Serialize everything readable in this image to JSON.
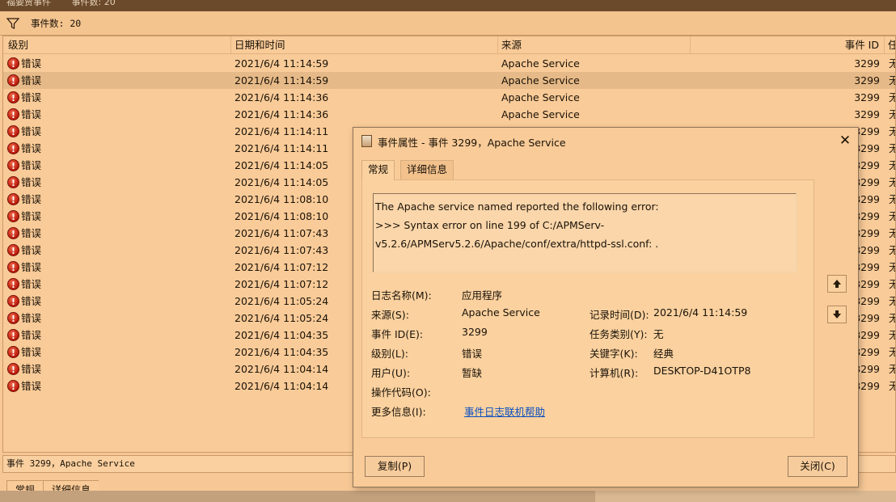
{
  "window": {
    "title_left": "福要贾事件",
    "title_right": "事件数: 20"
  },
  "filter": {
    "count_label": "事件数: 20"
  },
  "list": {
    "columns": [
      "级别",
      "日期和时间",
      "来源",
      "事件 ID",
      "任"
    ],
    "rows": [
      {
        "level": "错误",
        "datetime": "2021/6/4 11:14:59",
        "source": "Apache Service",
        "id": "3299",
        "task": "无"
      },
      {
        "level": "错误",
        "datetime": "2021/6/4 11:14:59",
        "source": "Apache Service",
        "id": "3299",
        "task": "无"
      },
      {
        "level": "错误",
        "datetime": "2021/6/4 11:14:36",
        "source": "Apache Service",
        "id": "3299",
        "task": "无"
      },
      {
        "level": "错误",
        "datetime": "2021/6/4 11:14:36",
        "source": "Apache Service",
        "id": "3299",
        "task": "无"
      },
      {
        "level": "错误",
        "datetime": "2021/6/4 11:14:11",
        "source": "",
        "id": "3299",
        "task": "无"
      },
      {
        "level": "错误",
        "datetime": "2021/6/4 11:14:11",
        "source": "",
        "id": "3299",
        "task": "无"
      },
      {
        "level": "错误",
        "datetime": "2021/6/4 11:14:05",
        "source": "",
        "id": "3299",
        "task": "无"
      },
      {
        "level": "错误",
        "datetime": "2021/6/4 11:14:05",
        "source": "",
        "id": "3299",
        "task": "无"
      },
      {
        "level": "错误",
        "datetime": "2021/6/4 11:08:10",
        "source": "",
        "id": "3299",
        "task": "无"
      },
      {
        "level": "错误",
        "datetime": "2021/6/4 11:08:10",
        "source": "",
        "id": "3299",
        "task": "无"
      },
      {
        "level": "错误",
        "datetime": "2021/6/4 11:07:43",
        "source": "",
        "id": "3299",
        "task": "无"
      },
      {
        "level": "错误",
        "datetime": "2021/6/4 11:07:43",
        "source": "",
        "id": "3299",
        "task": "无"
      },
      {
        "level": "错误",
        "datetime": "2021/6/4 11:07:12",
        "source": "",
        "id": "3299",
        "task": "无"
      },
      {
        "level": "错误",
        "datetime": "2021/6/4 11:07:12",
        "source": "",
        "id": "3299",
        "task": "无"
      },
      {
        "level": "错误",
        "datetime": "2021/6/4 11:05:24",
        "source": "",
        "id": "3299",
        "task": "无"
      },
      {
        "level": "错误",
        "datetime": "2021/6/4 11:05:24",
        "source": "",
        "id": "3299",
        "task": "无"
      },
      {
        "level": "错误",
        "datetime": "2021/6/4 11:04:35",
        "source": "",
        "id": "3299",
        "task": "无"
      },
      {
        "level": "错误",
        "datetime": "2021/6/4 11:04:35",
        "source": "",
        "id": "3299",
        "task": "无"
      },
      {
        "level": "错误",
        "datetime": "2021/6/4 11:04:14",
        "source": "",
        "id": "3299",
        "task": "无"
      },
      {
        "level": "错误",
        "datetime": "2021/6/4 11:04:14",
        "source": "",
        "id": "3299",
        "task": "无"
      }
    ]
  },
  "status": {
    "text": "事件 3299，Apache Service"
  },
  "bottom_tabs": [
    "常规",
    "详细信息"
  ],
  "dialog": {
    "title": "事件属性 - 事件 3299，Apache Service",
    "close_glyph": "✕",
    "tabs": [
      "常规",
      "详细信息"
    ],
    "message_lines": [
      "The Apache service named  reported the following error:",
      ">>> Syntax error on line 199 of C:/APMServ-",
      "v5.2.6/APMServ5.2.6/Apache/conf/extra/httpd-ssl.conf:     ."
    ],
    "fields": {
      "log_name_label": "日志名称(M):",
      "log_name": "应用程序",
      "source_label": "来源(S):",
      "source": "Apache Service",
      "logged_label": "记录时间(D):",
      "logged": "2021/6/4 11:14:59",
      "event_id_label": "事件 ID(E):",
      "event_id": "3299",
      "task_label": "任务类别(Y):",
      "task": "无",
      "level_label": "级别(L):",
      "level": "错误",
      "keywords_label": "关键字(K):",
      "keywords": "经典",
      "user_label": "用户(U):",
      "user": "暂缺",
      "computer_label": "计算机(R):",
      "computer": "DESKTOP-D41OTP8",
      "opcode_label": "操作代码(O):",
      "more_info_label": "更多信息(I):",
      "more_info_link": "事件日志联机帮助"
    },
    "copy_button": "复制(P)",
    "close_button": "关闭(C)"
  },
  "colors": {
    "background": "#f7c896",
    "selected_row": "#e6ba88",
    "link": "#0b4fc0",
    "error_icon": "#b8180a"
  }
}
